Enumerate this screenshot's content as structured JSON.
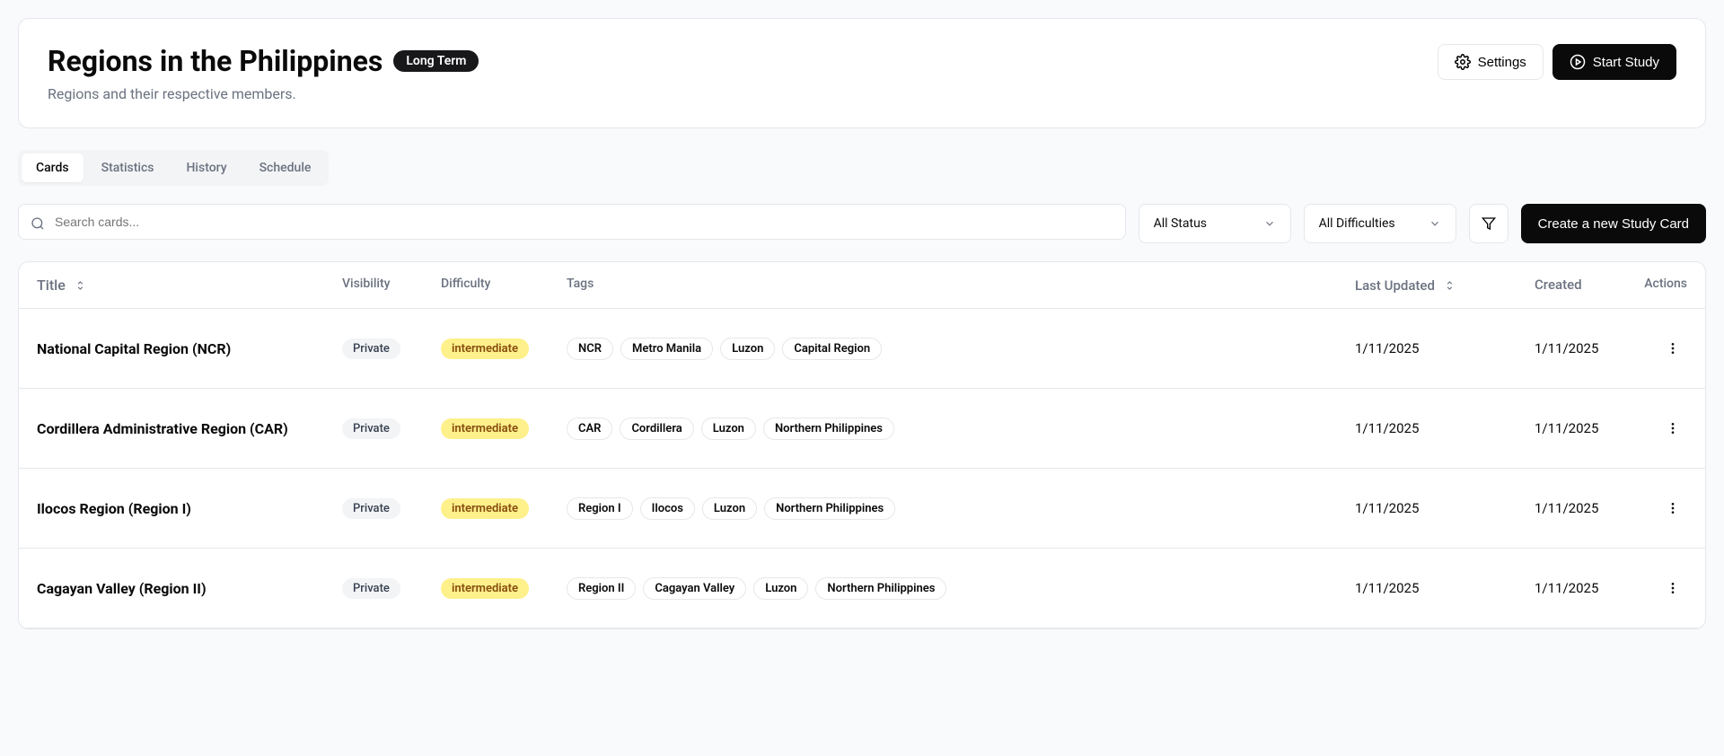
{
  "header": {
    "title": "Regions in the Philippines",
    "badge": "Long Term",
    "subtitle": "Regions and their respective members.",
    "settings_label": "Settings",
    "start_label": "Start Study"
  },
  "tabs": [
    "Cards",
    "Statistics",
    "History",
    "Schedule"
  ],
  "filters": {
    "search_placeholder": "Search cards...",
    "status_label": "All Status",
    "difficulty_label": "All Difficulties",
    "create_label": "Create a new Study Card"
  },
  "columns": {
    "title": "Title",
    "visibility": "Visibility",
    "difficulty": "Difficulty",
    "tags": "Tags",
    "updated": "Last Updated",
    "created": "Created",
    "actions": "Actions"
  },
  "rows": [
    {
      "title": "National Capital Region (NCR)",
      "visibility": "Private",
      "difficulty": "intermediate",
      "tags": [
        "NCR",
        "Metro Manila",
        "Luzon",
        "Capital Region"
      ],
      "updated": "1/11/2025",
      "created": "1/11/2025"
    },
    {
      "title": "Cordillera Administrative Region (CAR)",
      "visibility": "Private",
      "difficulty": "intermediate",
      "tags": [
        "CAR",
        "Cordillera",
        "Luzon",
        "Northern Philippines"
      ],
      "updated": "1/11/2025",
      "created": "1/11/2025"
    },
    {
      "title": "Ilocos Region (Region I)",
      "visibility": "Private",
      "difficulty": "intermediate",
      "tags": [
        "Region I",
        "Ilocos",
        "Luzon",
        "Northern Philippines"
      ],
      "updated": "1/11/2025",
      "created": "1/11/2025"
    },
    {
      "title": "Cagayan Valley (Region II)",
      "visibility": "Private",
      "difficulty": "intermediate",
      "tags": [
        "Region II",
        "Cagayan Valley",
        "Luzon",
        "Northern Philippines"
      ],
      "updated": "1/11/2025",
      "created": "1/11/2025"
    }
  ]
}
